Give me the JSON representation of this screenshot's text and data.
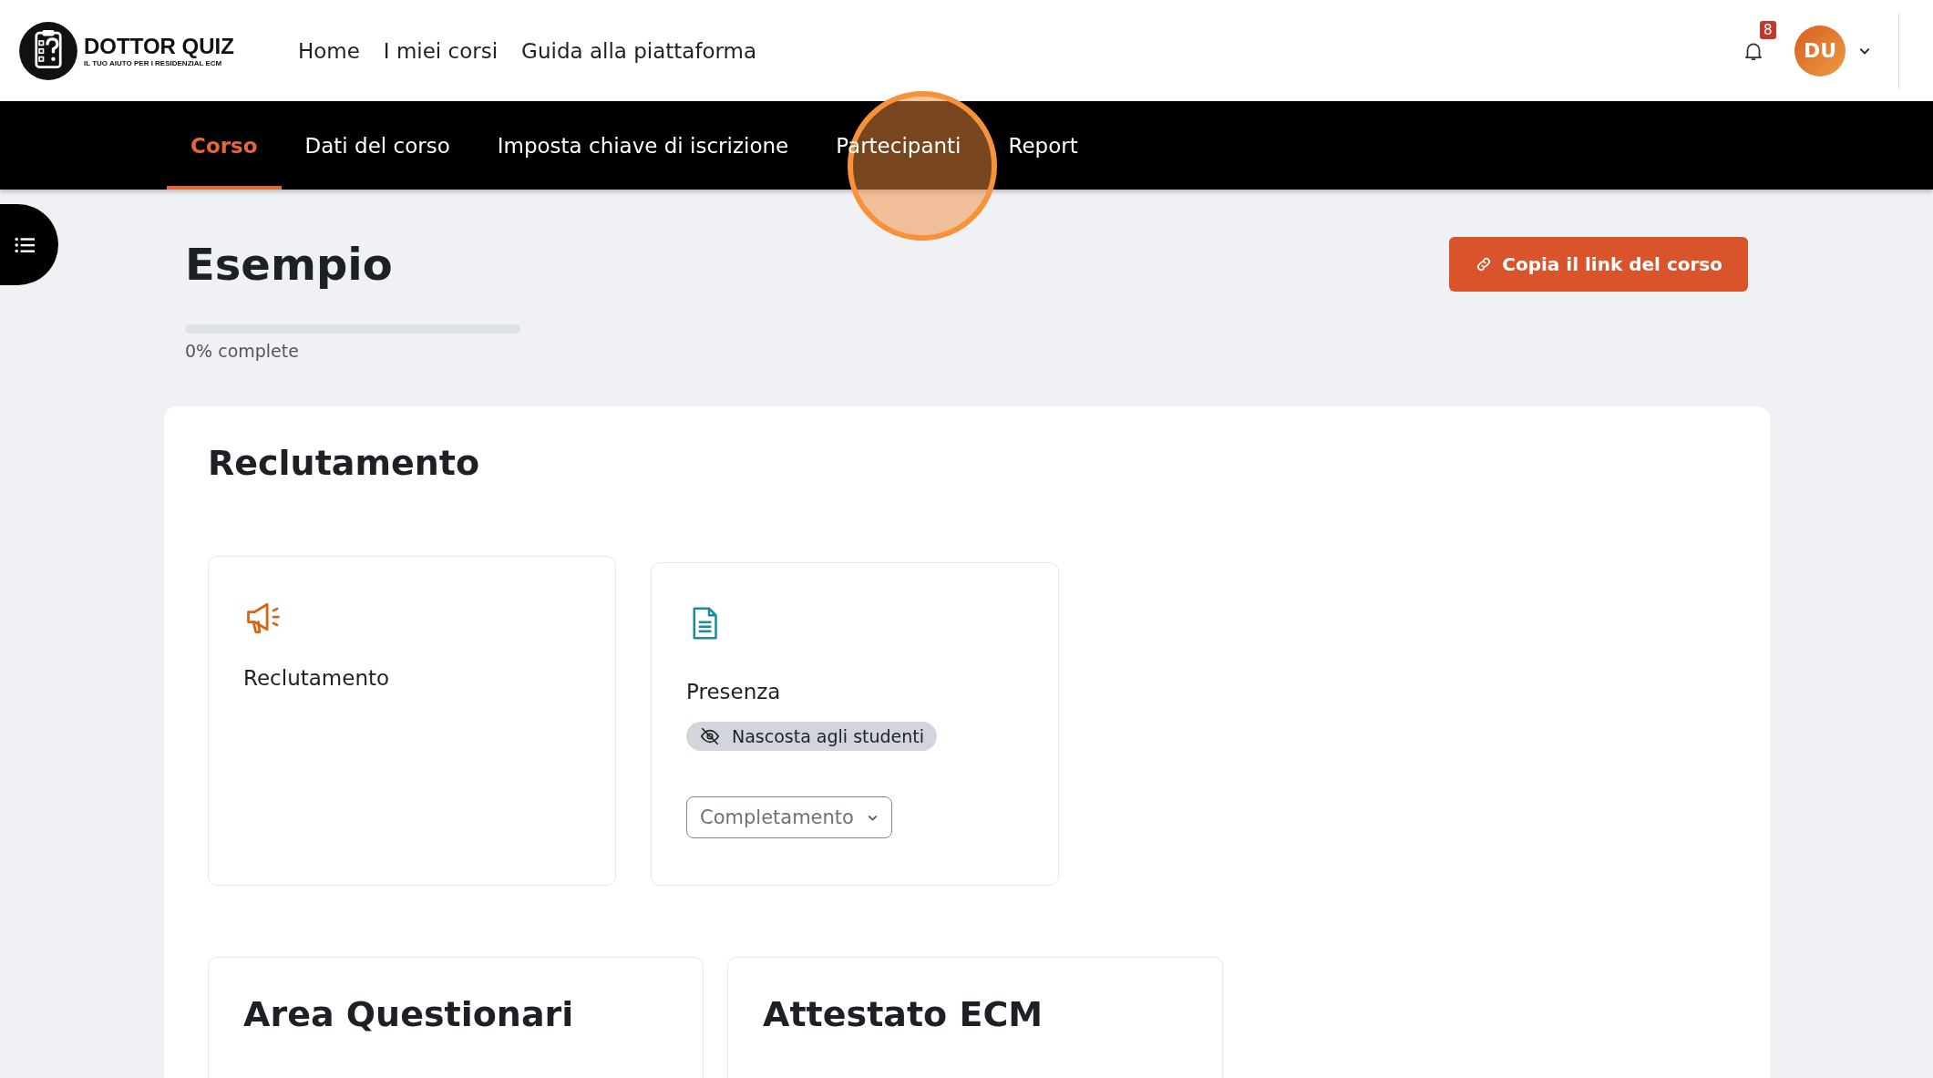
{
  "header": {
    "logo": {
      "title": "DOTTOR QUIZ",
      "tagline": "IL TUO AIUTO PER I RESIDENZIAL ECM"
    },
    "nav": [
      "Home",
      "I miei corsi",
      "Guida alla piattaforma"
    ],
    "notifications": {
      "count": "8"
    },
    "user": {
      "initials": "DU"
    }
  },
  "course_tabs": [
    {
      "label": "Corso",
      "selected": true
    },
    {
      "label": "Dati del corso",
      "selected": false
    },
    {
      "label": "Imposta chiave di iscrizione",
      "selected": false
    },
    {
      "label": "Partecipanti",
      "selected": false
    },
    {
      "label": "Report",
      "selected": false
    }
  ],
  "page": {
    "title": "Esempio",
    "copy_button": "Copia il link del corso",
    "progress": {
      "level": 0,
      "label": "0% complete"
    }
  },
  "section": {
    "title": "Reclutamento",
    "activities": [
      {
        "kind": "announcement",
        "name": "Reclutamento"
      },
      {
        "kind": "page",
        "name": "Presenza",
        "badge": "Nascosta agli studenti",
        "completion": "Completamento"
      }
    ]
  },
  "subsections": [
    {
      "title": "Area Questionari"
    },
    {
      "title": "Attestato ECM"
    }
  ]
}
